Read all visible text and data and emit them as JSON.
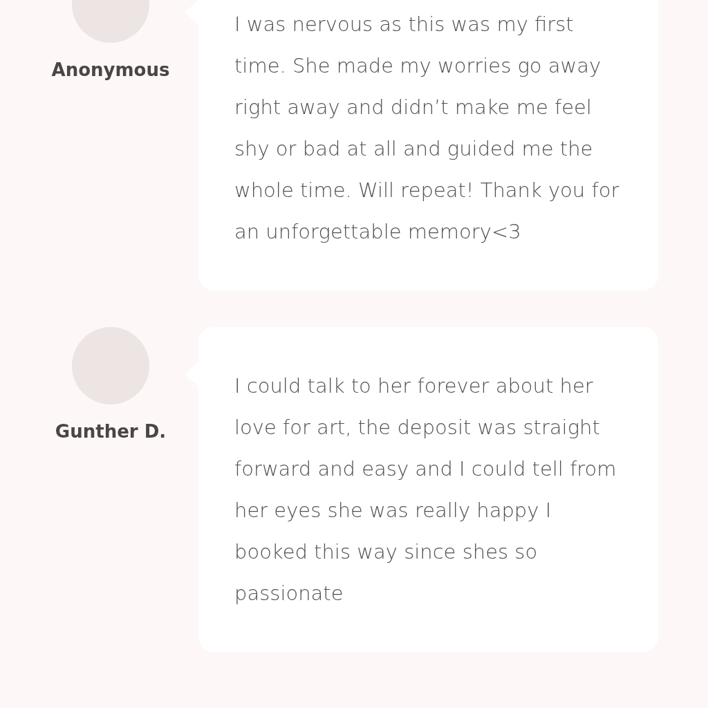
{
  "reviews": [
    {
      "name": "Anonymous",
      "text": "I was nervous as this was my first time. She made my worries go away right away and didn’t make me feel shy or bad at all and guided me the whole time. Will repeat! Thank you for an unforgettable memory<3"
    },
    {
      "name": "Gunther D.",
      "text": "I could talk to her forever about her love for art, the deposit was straight forward and easy and I could tell from her eyes she was really happy I booked this way since shes so passionate"
    }
  ]
}
